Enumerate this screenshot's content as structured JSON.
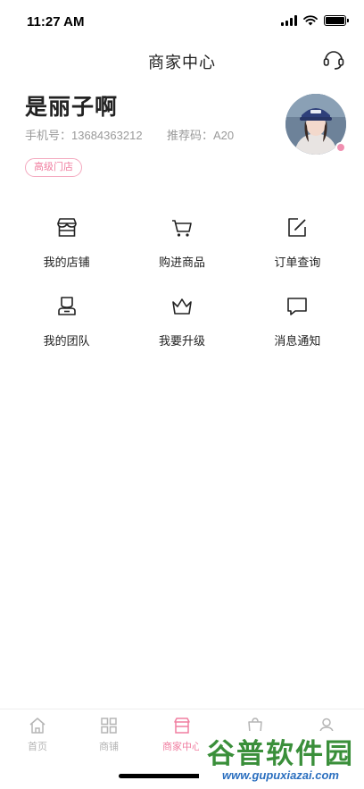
{
  "status_bar": {
    "time": "11:27 AM",
    "icons": [
      "cellular-signal-icon",
      "wifi-icon",
      "battery-icon"
    ]
  },
  "nav": {
    "title": "商家中心",
    "right_icon": "customer-service-headset-icon"
  },
  "profile": {
    "name": "是丽子啊",
    "phone_label": "手机号：",
    "phone": "13684363212",
    "referral_label": "推荐码：",
    "referral_code": "A20",
    "level_badge": "高级门店",
    "avatar": "user-avatar-photo"
  },
  "menu": [
    {
      "label": "我的店铺",
      "icon": "store-icon"
    },
    {
      "label": "购进商品",
      "icon": "cart-icon"
    },
    {
      "label": "订单查询",
      "icon": "edit-icon"
    },
    {
      "label": "我的团队",
      "icon": "team-icon"
    },
    {
      "label": "我要升级",
      "icon": "crown-icon"
    },
    {
      "label": "消息通知",
      "icon": "message-icon"
    }
  ],
  "tab_bar": {
    "active_tab": "商家中心",
    "tabs": [
      {
        "label": "首页",
        "icon": "home-icon"
      },
      {
        "label": "商铺",
        "icon": "grid-icon"
      },
      {
        "label": "商家中心",
        "icon": "merchant-icon"
      },
      {
        "label": "",
        "icon": "bag-icon"
      },
      {
        "label": "",
        "icon": "user-icon"
      }
    ]
  },
  "colors": {
    "accent": "#f07ea0",
    "text": "#222222",
    "muted": "#9a9a9a",
    "tab_inactive": "#b5b5b5"
  },
  "watermark": {
    "main": "谷普软件园",
    "sub": "www.gupuxiazai.com"
  }
}
